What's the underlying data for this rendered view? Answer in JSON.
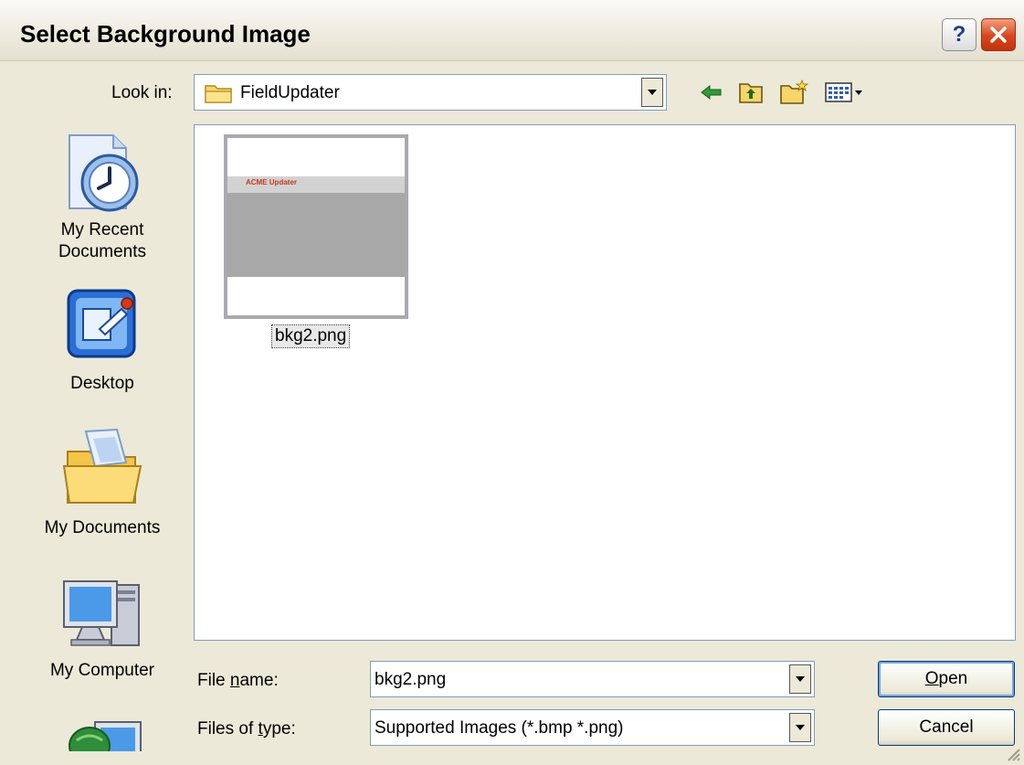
{
  "window": {
    "title": "Select Background Image"
  },
  "lookin": {
    "label": "Look in:",
    "value": "FieldUpdater"
  },
  "toolbar": {
    "back_icon": "back-arrow-icon",
    "up_icon": "up-one-level-icon",
    "newfolder_icon": "new-folder-icon",
    "views_icon": "views-menu-icon"
  },
  "places": [
    {
      "label": "My Recent\nDocuments",
      "icon": "recent-documents-icon"
    },
    {
      "label": "Desktop",
      "icon": "desktop-icon"
    },
    {
      "label": "My Documents",
      "icon": "my-documents-icon"
    },
    {
      "label": "My Computer",
      "icon": "my-computer-icon"
    }
  ],
  "files": [
    {
      "name": "bkg2.png",
      "thumb_text": "ACME Updater"
    }
  ],
  "filename": {
    "label": "File name:",
    "value": "bkg2.png"
  },
  "filetype": {
    "label": "Files of type:",
    "value": "Supported Images (*.bmp *.png)"
  },
  "buttons": {
    "open": "Open",
    "cancel": "Cancel"
  },
  "colors": {
    "accent": "#0a246a",
    "close": "#d8461c"
  }
}
